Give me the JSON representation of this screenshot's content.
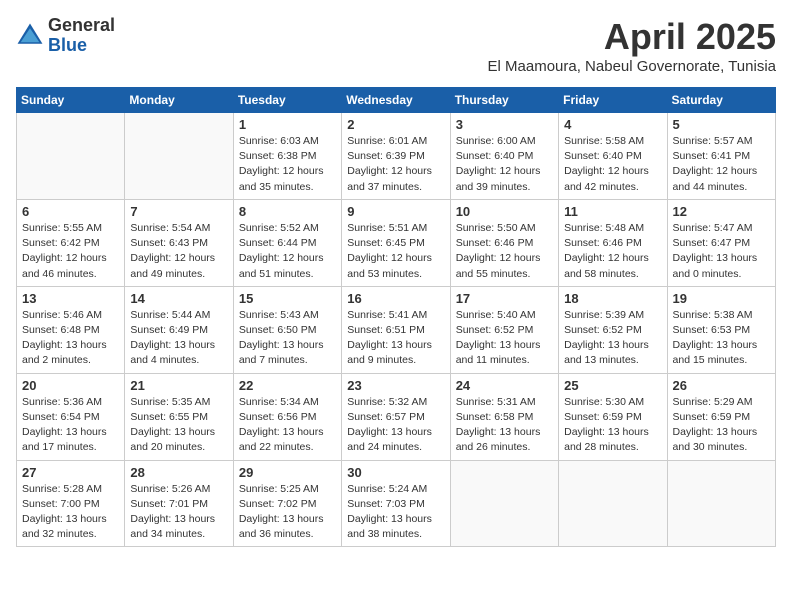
{
  "logo": {
    "general": "General",
    "blue": "Blue"
  },
  "title": "April 2025",
  "location": "El Maamoura, Nabeul Governorate, Tunisia",
  "days_of_week": [
    "Sunday",
    "Monday",
    "Tuesday",
    "Wednesday",
    "Thursday",
    "Friday",
    "Saturday"
  ],
  "weeks": [
    [
      {
        "day": "",
        "info": ""
      },
      {
        "day": "",
        "info": ""
      },
      {
        "day": "1",
        "info": "Sunrise: 6:03 AM\nSunset: 6:38 PM\nDaylight: 12 hours and 35 minutes."
      },
      {
        "day": "2",
        "info": "Sunrise: 6:01 AM\nSunset: 6:39 PM\nDaylight: 12 hours and 37 minutes."
      },
      {
        "day": "3",
        "info": "Sunrise: 6:00 AM\nSunset: 6:40 PM\nDaylight: 12 hours and 39 minutes."
      },
      {
        "day": "4",
        "info": "Sunrise: 5:58 AM\nSunset: 6:40 PM\nDaylight: 12 hours and 42 minutes."
      },
      {
        "day": "5",
        "info": "Sunrise: 5:57 AM\nSunset: 6:41 PM\nDaylight: 12 hours and 44 minutes."
      }
    ],
    [
      {
        "day": "6",
        "info": "Sunrise: 5:55 AM\nSunset: 6:42 PM\nDaylight: 12 hours and 46 minutes."
      },
      {
        "day": "7",
        "info": "Sunrise: 5:54 AM\nSunset: 6:43 PM\nDaylight: 12 hours and 49 minutes."
      },
      {
        "day": "8",
        "info": "Sunrise: 5:52 AM\nSunset: 6:44 PM\nDaylight: 12 hours and 51 minutes."
      },
      {
        "day": "9",
        "info": "Sunrise: 5:51 AM\nSunset: 6:45 PM\nDaylight: 12 hours and 53 minutes."
      },
      {
        "day": "10",
        "info": "Sunrise: 5:50 AM\nSunset: 6:46 PM\nDaylight: 12 hours and 55 minutes."
      },
      {
        "day": "11",
        "info": "Sunrise: 5:48 AM\nSunset: 6:46 PM\nDaylight: 12 hours and 58 minutes."
      },
      {
        "day": "12",
        "info": "Sunrise: 5:47 AM\nSunset: 6:47 PM\nDaylight: 13 hours and 0 minutes."
      }
    ],
    [
      {
        "day": "13",
        "info": "Sunrise: 5:46 AM\nSunset: 6:48 PM\nDaylight: 13 hours and 2 minutes."
      },
      {
        "day": "14",
        "info": "Sunrise: 5:44 AM\nSunset: 6:49 PM\nDaylight: 13 hours and 4 minutes."
      },
      {
        "day": "15",
        "info": "Sunrise: 5:43 AM\nSunset: 6:50 PM\nDaylight: 13 hours and 7 minutes."
      },
      {
        "day": "16",
        "info": "Sunrise: 5:41 AM\nSunset: 6:51 PM\nDaylight: 13 hours and 9 minutes."
      },
      {
        "day": "17",
        "info": "Sunrise: 5:40 AM\nSunset: 6:52 PM\nDaylight: 13 hours and 11 minutes."
      },
      {
        "day": "18",
        "info": "Sunrise: 5:39 AM\nSunset: 6:52 PM\nDaylight: 13 hours and 13 minutes."
      },
      {
        "day": "19",
        "info": "Sunrise: 5:38 AM\nSunset: 6:53 PM\nDaylight: 13 hours and 15 minutes."
      }
    ],
    [
      {
        "day": "20",
        "info": "Sunrise: 5:36 AM\nSunset: 6:54 PM\nDaylight: 13 hours and 17 minutes."
      },
      {
        "day": "21",
        "info": "Sunrise: 5:35 AM\nSunset: 6:55 PM\nDaylight: 13 hours and 20 minutes."
      },
      {
        "day": "22",
        "info": "Sunrise: 5:34 AM\nSunset: 6:56 PM\nDaylight: 13 hours and 22 minutes."
      },
      {
        "day": "23",
        "info": "Sunrise: 5:32 AM\nSunset: 6:57 PM\nDaylight: 13 hours and 24 minutes."
      },
      {
        "day": "24",
        "info": "Sunrise: 5:31 AM\nSunset: 6:58 PM\nDaylight: 13 hours and 26 minutes."
      },
      {
        "day": "25",
        "info": "Sunrise: 5:30 AM\nSunset: 6:59 PM\nDaylight: 13 hours and 28 minutes."
      },
      {
        "day": "26",
        "info": "Sunrise: 5:29 AM\nSunset: 6:59 PM\nDaylight: 13 hours and 30 minutes."
      }
    ],
    [
      {
        "day": "27",
        "info": "Sunrise: 5:28 AM\nSunset: 7:00 PM\nDaylight: 13 hours and 32 minutes."
      },
      {
        "day": "28",
        "info": "Sunrise: 5:26 AM\nSunset: 7:01 PM\nDaylight: 13 hours and 34 minutes."
      },
      {
        "day": "29",
        "info": "Sunrise: 5:25 AM\nSunset: 7:02 PM\nDaylight: 13 hours and 36 minutes."
      },
      {
        "day": "30",
        "info": "Sunrise: 5:24 AM\nSunset: 7:03 PM\nDaylight: 13 hours and 38 minutes."
      },
      {
        "day": "",
        "info": ""
      },
      {
        "day": "",
        "info": ""
      },
      {
        "day": "",
        "info": ""
      }
    ]
  ]
}
